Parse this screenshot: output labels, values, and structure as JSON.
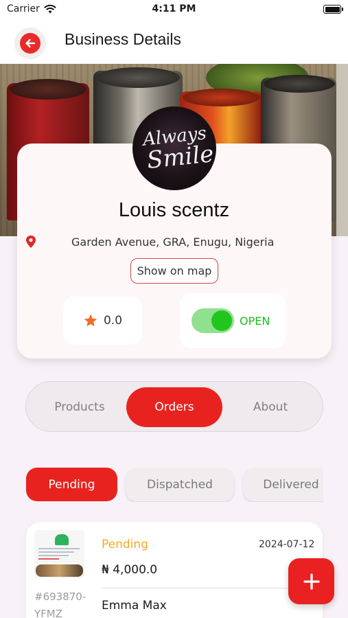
{
  "status_bar": {
    "carrier": "Carrier",
    "time": "4:11 PM"
  },
  "header": {
    "title": "Business Details"
  },
  "business": {
    "logo_line_1": "Always",
    "logo_line_2": "Smile",
    "name": "Louis scentz",
    "address": "Garden Avenue, GRA, Enugu, Nigeria",
    "map_button": "Show on map",
    "rating": "0.0",
    "status_label": "OPEN",
    "is_open": true
  },
  "tabs": [
    {
      "label": "Products",
      "active": false
    },
    {
      "label": "Orders",
      "active": true
    },
    {
      "label": "About",
      "active": false
    }
  ],
  "filters": [
    {
      "label": "Pending",
      "active": true
    },
    {
      "label": "Dispatched",
      "active": false
    },
    {
      "label": "Delivered",
      "active": false
    }
  ],
  "order": {
    "status": "Pending",
    "date": "2024-07-12",
    "amount": "₦ 4,000.0",
    "order_id": "#693870-YFMZ",
    "customer": "Emma Max"
  },
  "colors": {
    "accent": "#e8231f",
    "open_green": "#22c51e",
    "pending_orange": "#f2ab1d"
  },
  "icons": {
    "back": "arrow-left-icon",
    "location": "location-pin-icon",
    "rating": "star-icon",
    "fab": "plus-icon"
  }
}
